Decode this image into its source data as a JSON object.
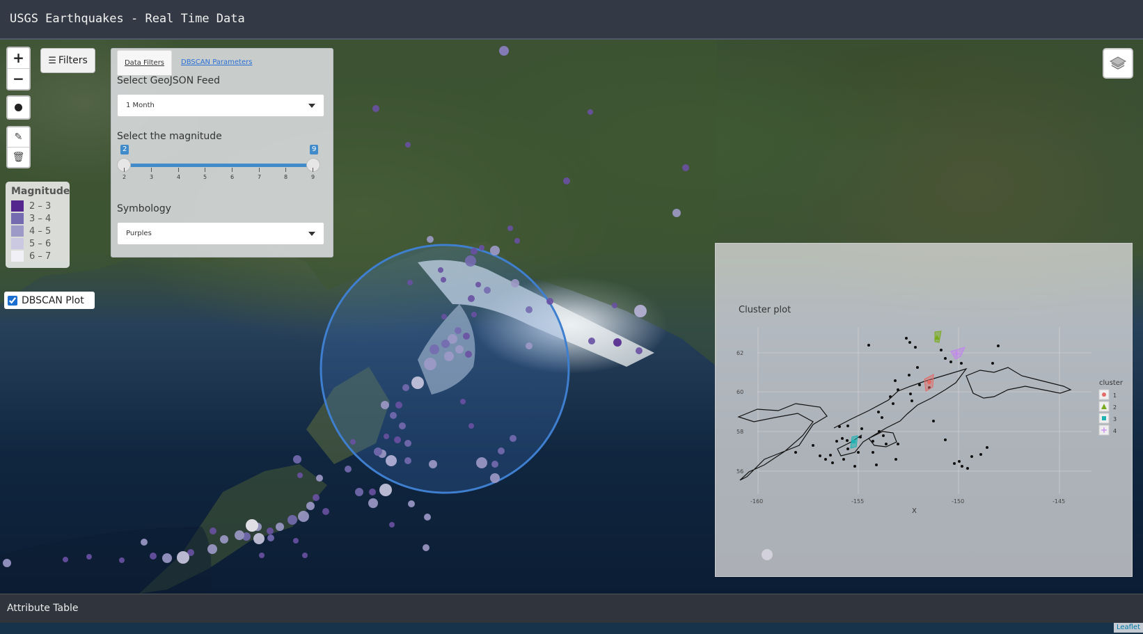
{
  "app": {
    "title": "USGS Earthquakes - Real Time Data"
  },
  "toolbar": {
    "zoom_in": "+",
    "zoom_out": "−",
    "filters_label": "Filters",
    "filters_icon": "sliders-icon",
    "draw_marker_icon": "circle-marker-icon",
    "edit_icon": "edit-icon",
    "delete_icon": "trash-icon",
    "layers_icon": "layers-icon"
  },
  "filter_panel": {
    "tabs": [
      {
        "label": "Data Filters",
        "active": true
      },
      {
        "label": "DBSCAN Parameters",
        "active": false
      }
    ],
    "feed_label": "Select GeoJSON Feed",
    "feed_value": "1 Month",
    "magnitude_label": "Select the magnitude",
    "magnitude_min": "2",
    "magnitude_max": "9",
    "magnitude_ticks": [
      "2",
      "3",
      "4",
      "5",
      "6",
      "7",
      "8",
      "9"
    ],
    "symbology_label": "Symbology",
    "symbology_value": "Purples"
  },
  "legend": {
    "title": "Magnitude",
    "items": [
      {
        "label": "2 – 3",
        "color": "#54278f"
      },
      {
        "label": "3 – 4",
        "color": "#756bb1"
      },
      {
        "label": "4 – 5",
        "color": "#9e9ac8"
      },
      {
        "label": "5 – 6",
        "color": "#cbc9e2"
      },
      {
        "label": "6 – 7",
        "color": "#f2f0f7"
      }
    ]
  },
  "dbscan": {
    "label": "DBSCAN Plot",
    "checked": true
  },
  "cluster_plot": {
    "title": "Cluster plot",
    "xlabel": "X",
    "x_ticks": [
      "-160",
      "-155",
      "-150",
      "-145"
    ],
    "y_ticks": [
      "62",
      "60",
      "58",
      "56"
    ],
    "legend_title": "cluster",
    "clusters": [
      {
        "label": "1",
        "color": "#e46b66"
      },
      {
        "label": "2",
        "color": "#7aab1f"
      },
      {
        "label": "3",
        "color": "#1fb2b2"
      },
      {
        "label": "4",
        "color": "#c381f0"
      }
    ]
  },
  "attribute_table": {
    "label": "Attribute Table"
  },
  "attribution": {
    "label": "Leaflet"
  }
}
